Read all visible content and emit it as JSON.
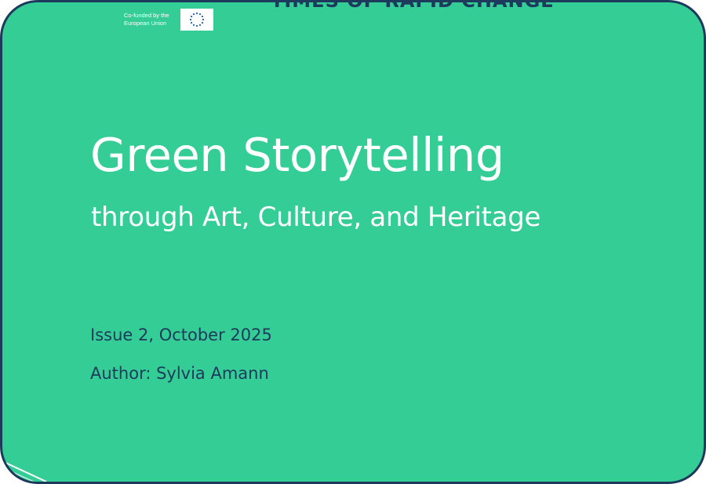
{
  "eu_badge": {
    "line1": "Co-funded by the",
    "line2": "European Union",
    "flag_icon": "eu-flag-icon",
    "star_color": "#1e5fae"
  },
  "top_cut_text": "TIMES OF RAPID CHANGE",
  "cover": {
    "title": "Green Storytelling",
    "subtitle": "through Art, Culture, and Heritage",
    "issue": "Issue 2, October 2025",
    "author": "Author: Sylvia Amann"
  },
  "colors": {
    "background": "#35cd96",
    "border": "#1d3a5c",
    "title_text": "#ffffff",
    "meta_text": "#1d3a5c"
  }
}
